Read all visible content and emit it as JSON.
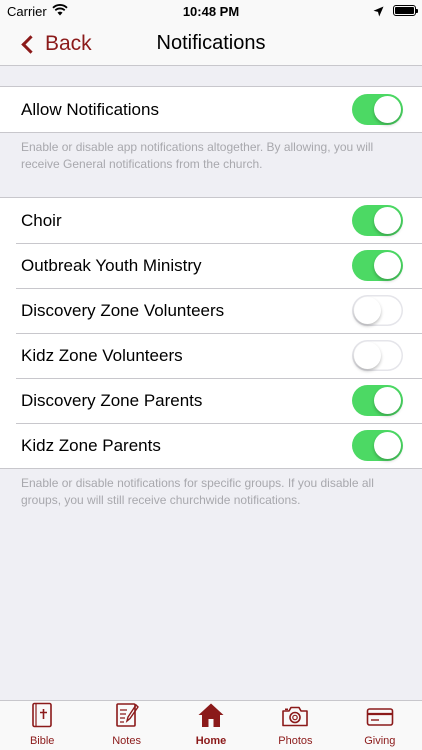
{
  "status_bar": {
    "carrier": "Carrier",
    "time": "10:48 PM"
  },
  "nav": {
    "back_label": "Back",
    "title": "Notifications"
  },
  "allow_section": {
    "label": "Allow Notifications",
    "enabled": true,
    "footnote": "Enable or disable app notifications altogether. By allowing, you will receive General notifications from the church."
  },
  "groups_section": {
    "items": [
      {
        "label": "Choir",
        "enabled": true
      },
      {
        "label": "Outbreak Youth Ministry",
        "enabled": true
      },
      {
        "label": "Discovery Zone Volunteers",
        "enabled": false
      },
      {
        "label": "Kidz Zone Volunteers",
        "enabled": false
      },
      {
        "label": "Discovery Zone Parents",
        "enabled": true
      },
      {
        "label": "Kidz Zone Parents",
        "enabled": true
      }
    ],
    "footnote": "Enable or disable notifications for specific groups. If you disable all groups, you will still receive churchwide notifications."
  },
  "tab_bar": {
    "tabs": [
      {
        "label": "Bible",
        "icon": "bible-icon"
      },
      {
        "label": "Notes",
        "icon": "notes-icon"
      },
      {
        "label": "Home",
        "icon": "home-icon",
        "active": true
      },
      {
        "label": "Photos",
        "icon": "camera-icon"
      },
      {
        "label": "Giving",
        "icon": "credit-card-icon"
      }
    ]
  },
  "colors": {
    "accent": "#8b1a1a",
    "toggle_on": "#4cd964",
    "background": "#efeff4"
  }
}
